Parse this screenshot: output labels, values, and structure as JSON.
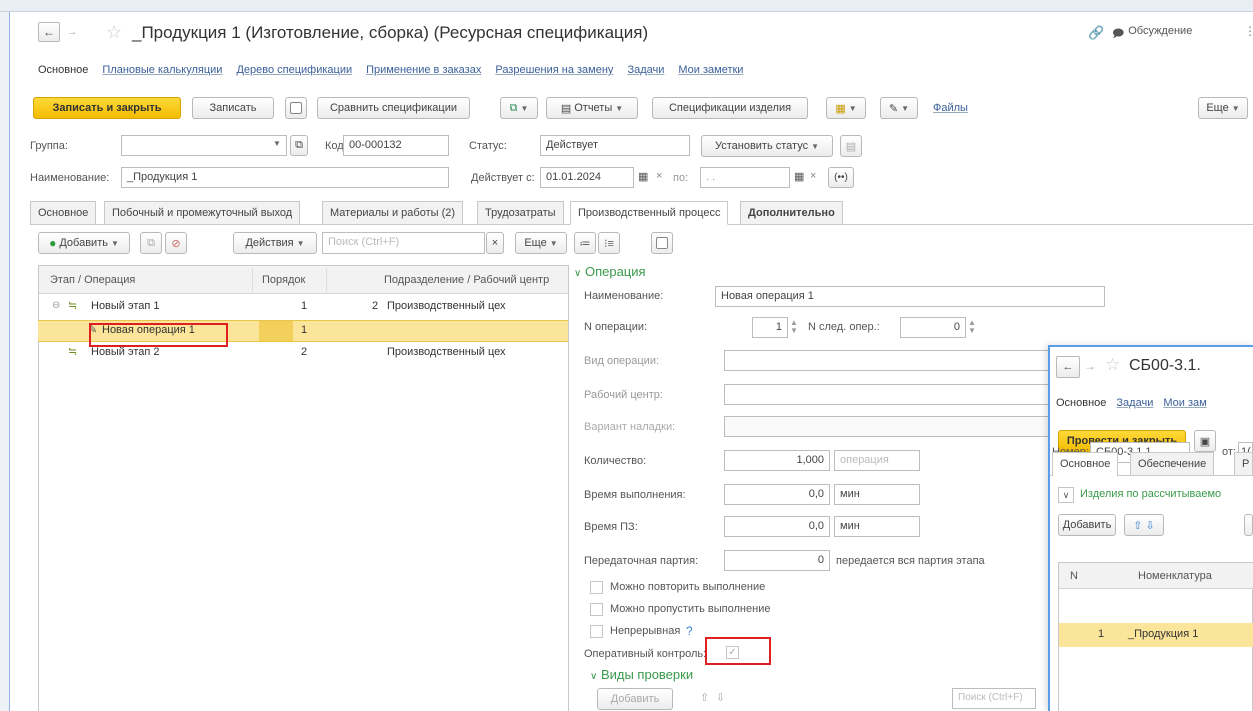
{
  "window": {
    "title": "_Продукция 1 (Изготовление, сборка) (Ресурсная спецификация)",
    "link_icon": "link-icon",
    "discussion": "Обсуждение"
  },
  "nav": [
    "Основное",
    "Плановые калькуляции",
    "Дерево спецификации",
    "Применение в заказах",
    "Разрешения на замену",
    "Задачи",
    "Мои заметки"
  ],
  "toolbar": {
    "save_close": "Записать и закрыть",
    "save": "Записать",
    "compare": "Сравнить спецификации",
    "reports": "Отчеты",
    "product_specs": "Спецификации изделия",
    "files": "Файлы",
    "more": "Еще"
  },
  "header": {
    "group_label": "Группа:",
    "group_value": "",
    "code_label": "Код:",
    "code_value": "00-000132",
    "status_label": "Статус:",
    "status_value": "Действует",
    "set_status": "Установить статус",
    "name_label": "Наименование:",
    "name_value": "_Продукция 1",
    "valid_from_label": "Действует с:",
    "valid_from_value": "01.01.2024",
    "to_label": "по:",
    "to_value": ". ."
  },
  "tabs": [
    "Основное",
    "Побочный и промежуточный выход",
    "Материалы и работы (2)",
    "Трудозатраты",
    "Производственный процесс",
    "Дополнительно"
  ],
  "list_toolbar": {
    "add": "Добавить",
    "actions": "Действия",
    "search_placeholder": "Поиск (Ctrl+F)",
    "clear": "×",
    "more": "Еще"
  },
  "table": {
    "columns": [
      "Этап / Операция",
      "Порядок",
      "Подразделение / Рабочий центр"
    ],
    "rows": [
      {
        "name": "Новый этап 1",
        "order": "1",
        "num": "2",
        "dept": "Производственный цех"
      },
      {
        "name": "Новая операция 1",
        "order": "1",
        "num": "",
        "dept": ""
      },
      {
        "name": "Новый этап 2",
        "order": "2",
        "num": "",
        "dept": "Производственный цех"
      }
    ]
  },
  "operation": {
    "section": "Операция",
    "name_label": "Наименование:",
    "name_value": "Новая операция 1",
    "num_label": "N операции:",
    "num_value": "1",
    "next_label": "N след. опер.:",
    "next_value": "0",
    "type_label": "Вид операции:",
    "center_label": "Рабочий центр:",
    "setup_label": "Вариант наладки:",
    "qty_label": "Количество:",
    "qty_value": "1,000",
    "qty_unit": "операция",
    "time_label": "Время выполнения:",
    "time_value": "0,0",
    "time_unit": "мин",
    "pz_label": "Время ПЗ:",
    "pz_value": "0,0",
    "pz_unit": "мин",
    "batch_label": "Передаточная партия:",
    "batch_value": "0",
    "batch_note": "передается вся партия этапа",
    "repeat": "Можно повторить выполнение",
    "skip": "Можно пропустить выполнение",
    "continuous": "Непрерывная",
    "continuous_help": "?",
    "control": "Оперативный контроль:",
    "checks_section": "Виды проверки",
    "checks_add": "Добавить",
    "checks_search": "Поиск (Ctrl+F)"
  },
  "doc2": {
    "title": "СБ00-3.1.",
    "nav": [
      "Основное",
      "Задачи",
      "Мои зам"
    ],
    "post_close": "Провести и закрыть",
    "number_label": "Номер:",
    "number_value": "СБ00-3.1.1",
    "date_label": "от:",
    "date_value": "1(",
    "tabs": [
      "Основное",
      "Обеспечение",
      "Р"
    ],
    "group": "Изделия по рассчитываемо",
    "add": "Добавить",
    "col_n": "N",
    "col_nom": "Номенклатура",
    "row_n": "1",
    "row_nom": "_Продукция 1"
  }
}
